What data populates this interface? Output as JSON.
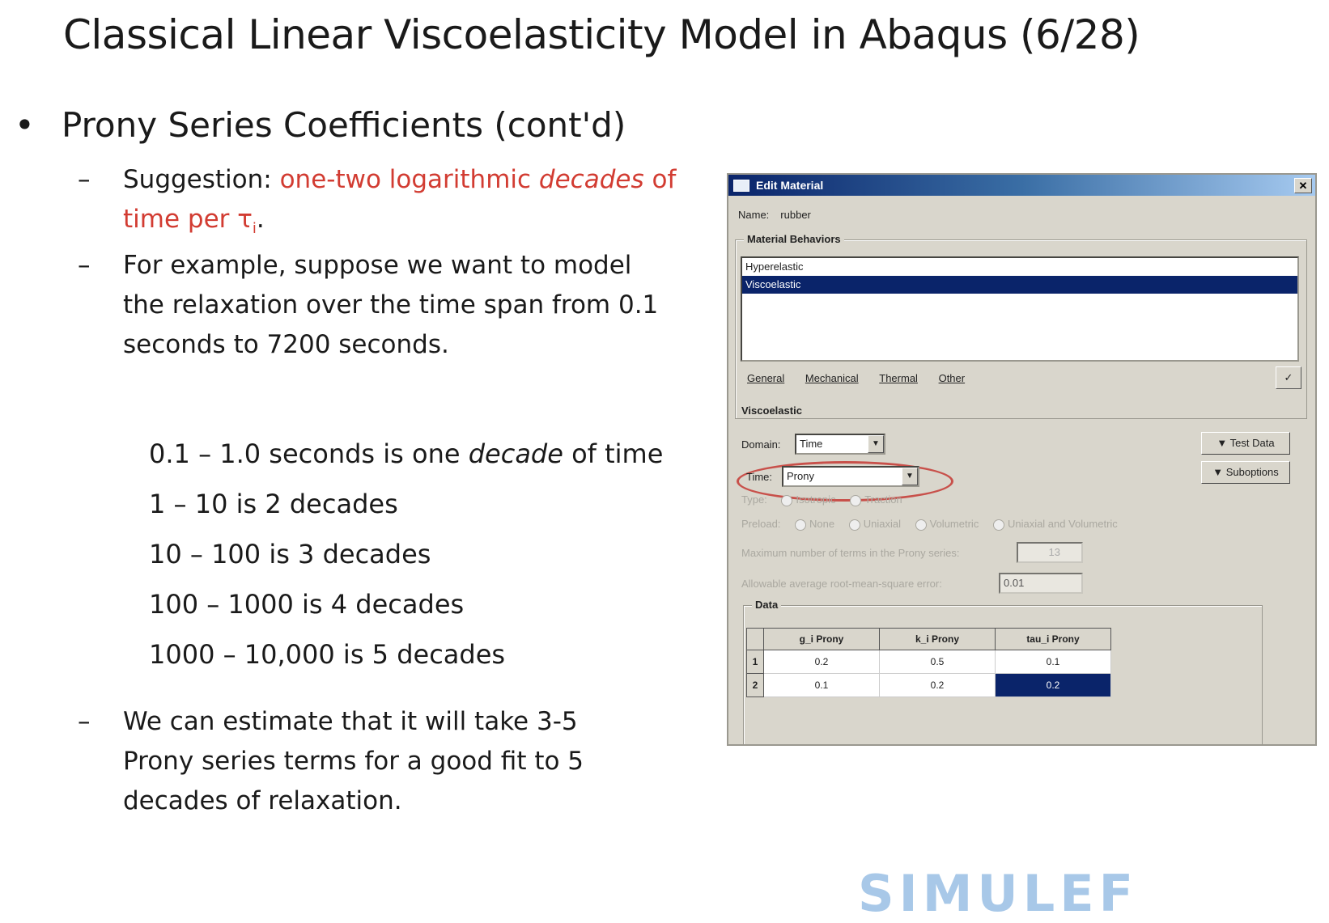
{
  "slide": {
    "title": "Classical Linear Viscoelasticity Model in Abaqus (6/28)",
    "bullet": "Prony Series Coefficients (cont'd)",
    "sub1_prefix": "Suggestion: ",
    "sub1_red_a": "one-two logarithmic ",
    "sub1_red_em": "decades",
    "sub1_red_b": " of time per τ",
    "sub1_red_sub": "i",
    "sub1_end": ".",
    "sub2": "For example, suppose we want to model the relaxation over the time span  from 0.1 seconds to 7200 seconds.",
    "decade1_a": "0.1 – 1.0 seconds is one ",
    "decade1_em": "decade",
    "decade1_b": " of time",
    "decade2": "1 – 10 is 2 decades",
    "decade3": "10 – 100 is 3 decades",
    "decade4": "100 – 1000 is 4 decades",
    "decade5": "1000 – 10,000 is 5 decades",
    "sub3": "We can estimate that it will take 3-5 Prony series terms for a good fit to 5 decades of relaxation.",
    "dash": "–",
    "bullet_mark": "•",
    "logo_text": "SIMULEF",
    "red_color": "#d23c32"
  },
  "dialog": {
    "title": "Edit Material",
    "close": "✕",
    "name_label": "Name:",
    "name_value": "rubber",
    "behaviors_label": "Material Behaviors",
    "behaviors": [
      "Hyperelastic",
      "Viscoelastic"
    ],
    "menu": [
      "General",
      "Mechanical",
      "Thermal",
      "Other"
    ],
    "section_label": "Viscoelastic",
    "domain_label": "Domain:",
    "domain_value": "Time",
    "time_label": "Time:",
    "time_value": "Prony",
    "test_data_btn": "▼ Test Data",
    "suboptions_btn": "▼ Suboptions",
    "type_label": "Type:",
    "type_options": [
      "Isotropic",
      "Traction"
    ],
    "preload_label": "Preload:",
    "preload_options": [
      "None",
      "Uniaxial",
      "Volumetric",
      "Uniaxial and Volumetric"
    ],
    "max_terms_label": "Maximum number of terms in the Prony series:",
    "max_terms_value": "13",
    "rms_label": "Allowable average root-mean-square error:",
    "rms_value": "0.01",
    "data_label": "Data",
    "table": {
      "headers": [
        "g_i Prony",
        "k_i Prony",
        "tau_i Prony"
      ],
      "rows": [
        {
          "n": "1",
          "g": "0.2",
          "k": "0.5",
          "tau": "0.1"
        },
        {
          "n": "2",
          "g": "0.1",
          "k": "0.2",
          "tau": "0.2"
        }
      ]
    }
  }
}
